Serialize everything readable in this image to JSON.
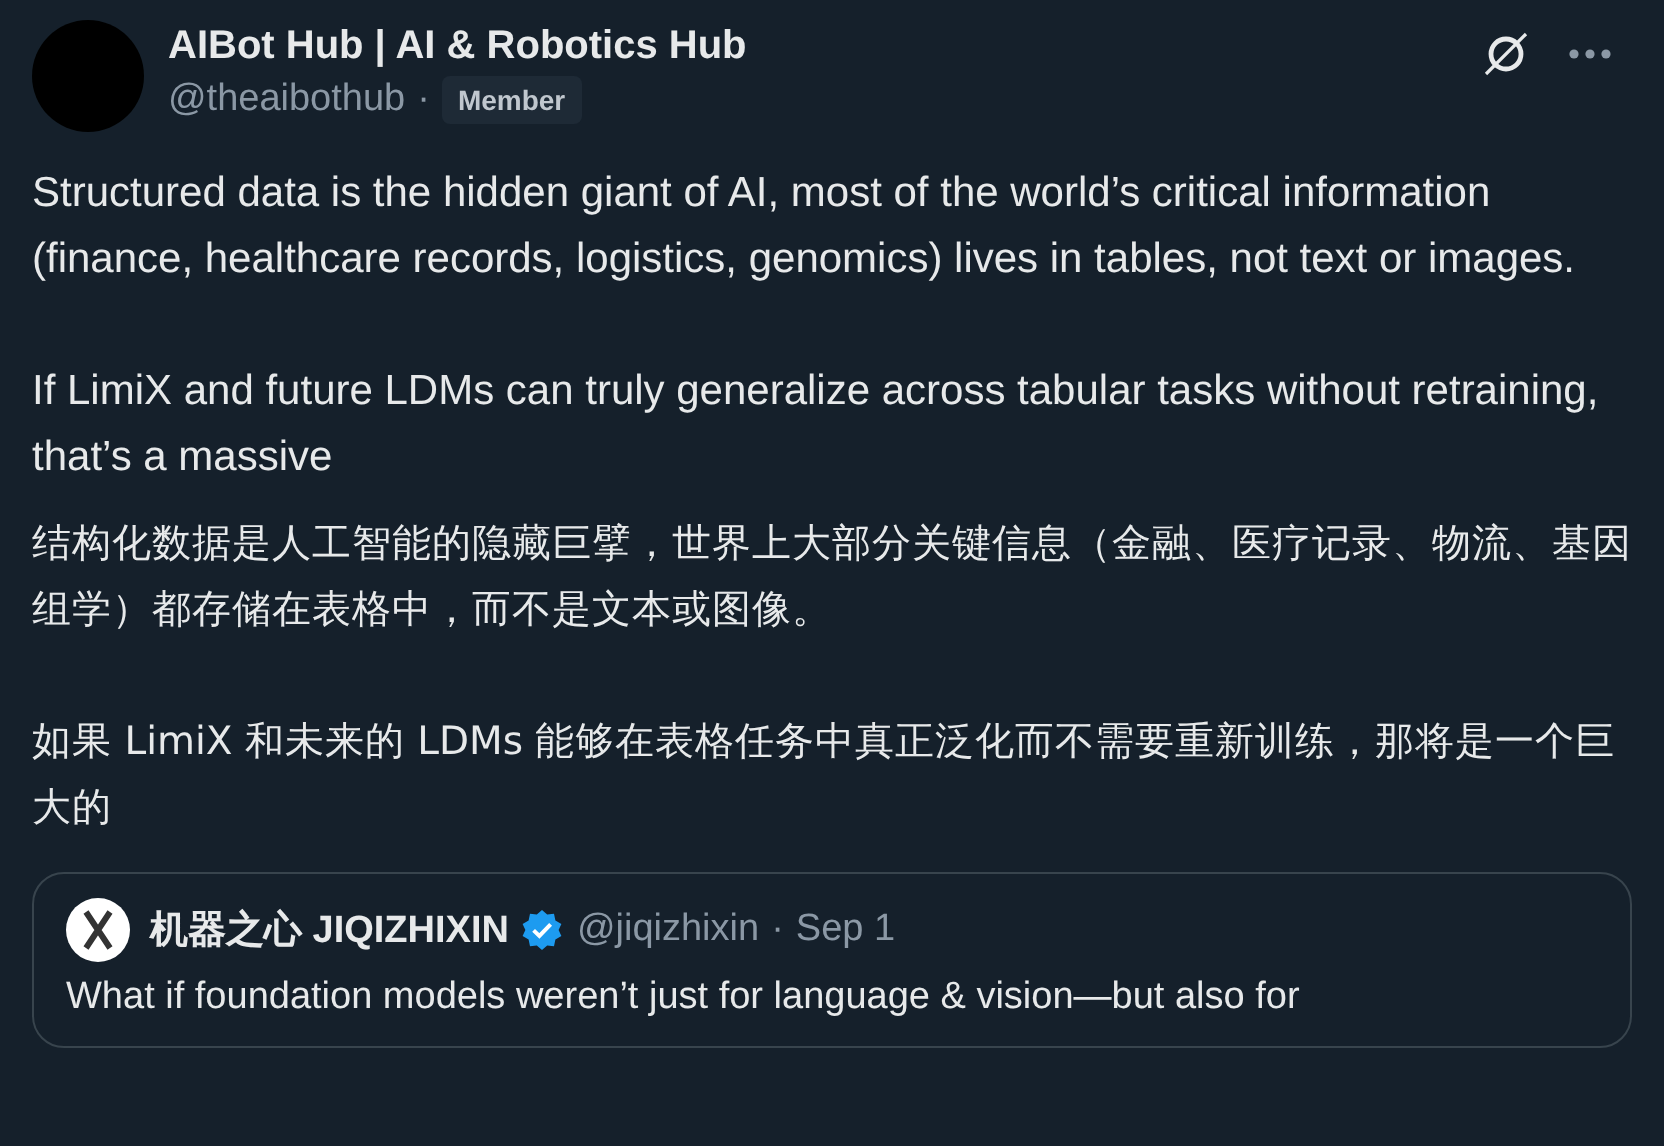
{
  "author": {
    "name": "AIBot Hub | AI & Robotics Hub",
    "handle": "@theaibothub",
    "separator": "·",
    "badge": "Member"
  },
  "paragraphs": [
    "Structured data is the hidden giant of AI, most of the world’s critical information (finance, healthcare records, logistics, genomics) lives in tables, not text or images.",
    "If LimiX and future LDMs can truly generalize across tabular tasks without retraining, that’s a massive"
  ],
  "translation": [
    "结构化数据是人工智能的隐藏巨擘，世界上大部分关键信息（金融、医疗记录、物流、基因组学）都存储在表格中，而不是文本或图像。",
    "如果 LimiX 和未来的 LDMs 能够在表格任务中真正泛化而不需要重新训练，那将是一个巨大的"
  ],
  "quoted": {
    "name": "机器之心 JIQIZHIXIN",
    "verified": true,
    "handle": "@jiqizhixin",
    "separator": "·",
    "date": "Sep 1",
    "text": "What if foundation models weren’t just for language & vision—but also for"
  }
}
